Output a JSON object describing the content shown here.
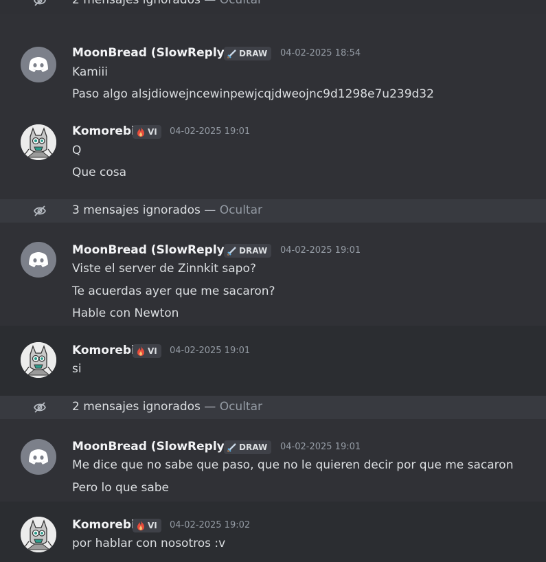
{
  "ignored": {
    "hide_label": "Ocultar",
    "separator": "—",
    "top_partial": "2 mensajes ignorados",
    "row2": "3 mensajes ignorados",
    "row3": "2 mensajes ignorados"
  },
  "messages": [
    {
      "author": "MoonBread (SlowReplys)",
      "tag": "DRAW",
      "timestamp": "04-02-2025 18:54",
      "lines": [
        "Kamiii",
        "Paso algo alsjdiowejncewinpewjcqjdweojnc9d1298e7u239d32"
      ]
    },
    {
      "author": "Komorebi",
      "tag": "VI",
      "timestamp": "04-02-2025 19:01",
      "lines": [
        "Q",
        "Que cosa"
      ]
    },
    {
      "author": "MoonBread (SlowReplys)",
      "tag": "DRAW",
      "timestamp": "04-02-2025 19:01",
      "lines": [
        "Viste el server de Zinnkit sapo?",
        "Te acuerdas ayer que me sacaron?",
        "Hable con Newton"
      ]
    },
    {
      "author": "Komorebi",
      "tag": "VI",
      "timestamp": "04-02-2025 19:01",
      "lines": [
        "si"
      ]
    },
    {
      "author": "MoonBread (SlowReplys)",
      "tag": "DRAW",
      "timestamp": "04-02-2025 19:01",
      "lines": [
        "Me dice que no sabe que paso, que no le quieren decir por que me sacaron",
        "Pero lo que sabe"
      ]
    },
    {
      "author": "Komorebi",
      "tag": "VI",
      "timestamp": "04-02-2025 19:02",
      "lines": [
        "por hablar con nosotros :v"
      ]
    }
  ],
  "icons": {
    "ignored": "eye-slash-icon",
    "draw_tag": "sword-icon",
    "vi_tag": "fire-icon",
    "moonbread_avatar": "discord-logo-icon",
    "komorebi_avatar": "cat-avatar"
  },
  "colors": {
    "background": "#303136",
    "ignored_band": "#383a40",
    "timestamp": "#949ba4",
    "avatar_discord": "#7c808a"
  }
}
